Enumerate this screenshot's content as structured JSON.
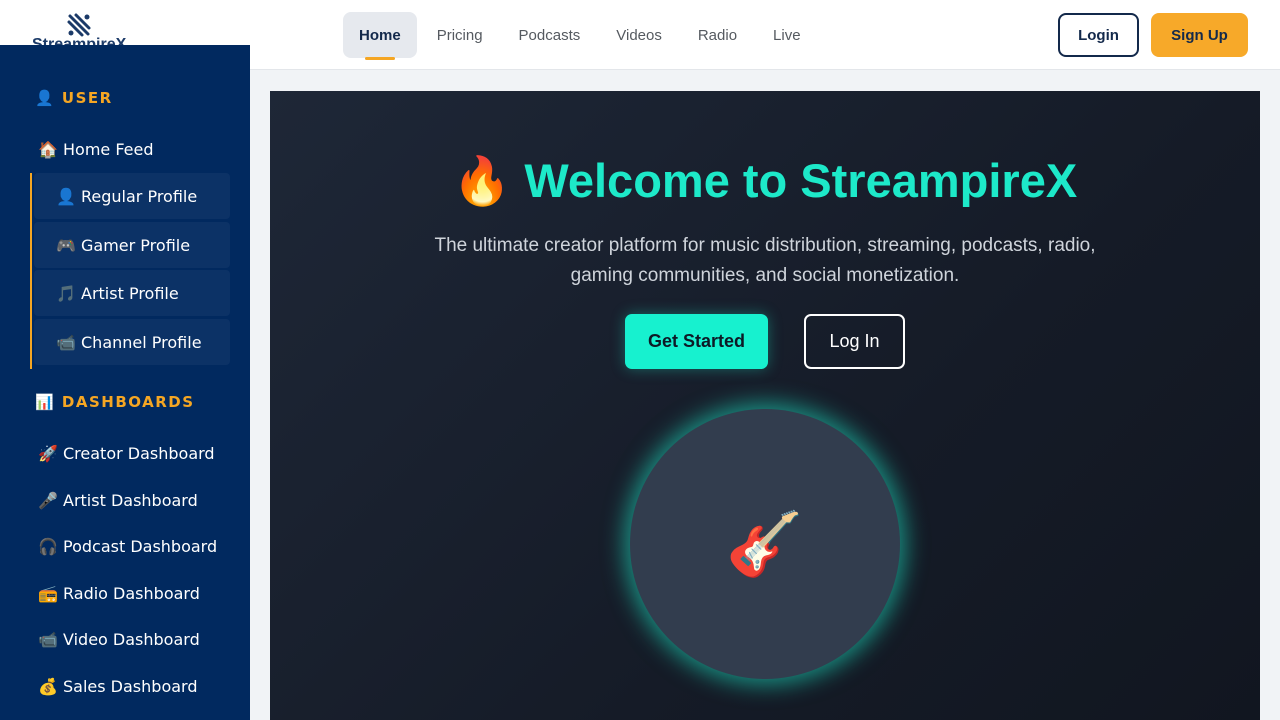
{
  "brand": {
    "name": "StreampireX"
  },
  "nav": {
    "items": [
      {
        "label": "Home",
        "active": true
      },
      {
        "label": "Pricing"
      },
      {
        "label": "Podcasts"
      },
      {
        "label": "Videos"
      },
      {
        "label": "Radio"
      },
      {
        "label": "Live"
      }
    ]
  },
  "header": {
    "login_label": "Login",
    "signup_label": "Sign Up"
  },
  "sidebar": {
    "user_heading": "👤 USER",
    "home_feed": "🏠 Home Feed",
    "profiles": [
      "👤 Regular Profile",
      "🎮 Gamer Profile",
      "🎵 Artist Profile",
      "📹 Channel Profile"
    ],
    "dashboards_heading": "📊 DASHBOARDS",
    "dashboards": [
      "🚀 Creator Dashboard",
      "🎤 Artist Dashboard",
      "🎧 Podcast Dashboard",
      "📻 Radio Dashboard",
      "📹 Video Dashboard",
      "💰 Sales Dashboard"
    ]
  },
  "hero": {
    "title": "🔥 Welcome to StreampireX",
    "subtitle": "The ultimate creator platform for music distribution, streaming, podcasts, radio, gaming communities, and social monetization.",
    "cta_primary": "Get Started",
    "cta_secondary": "Log In",
    "feature_icon": "🎸"
  },
  "colors": {
    "accent_teal": "#1de9c9",
    "accent_orange": "#f5a623",
    "sidebar_bg": "#01295f",
    "navy": "#13294b"
  }
}
